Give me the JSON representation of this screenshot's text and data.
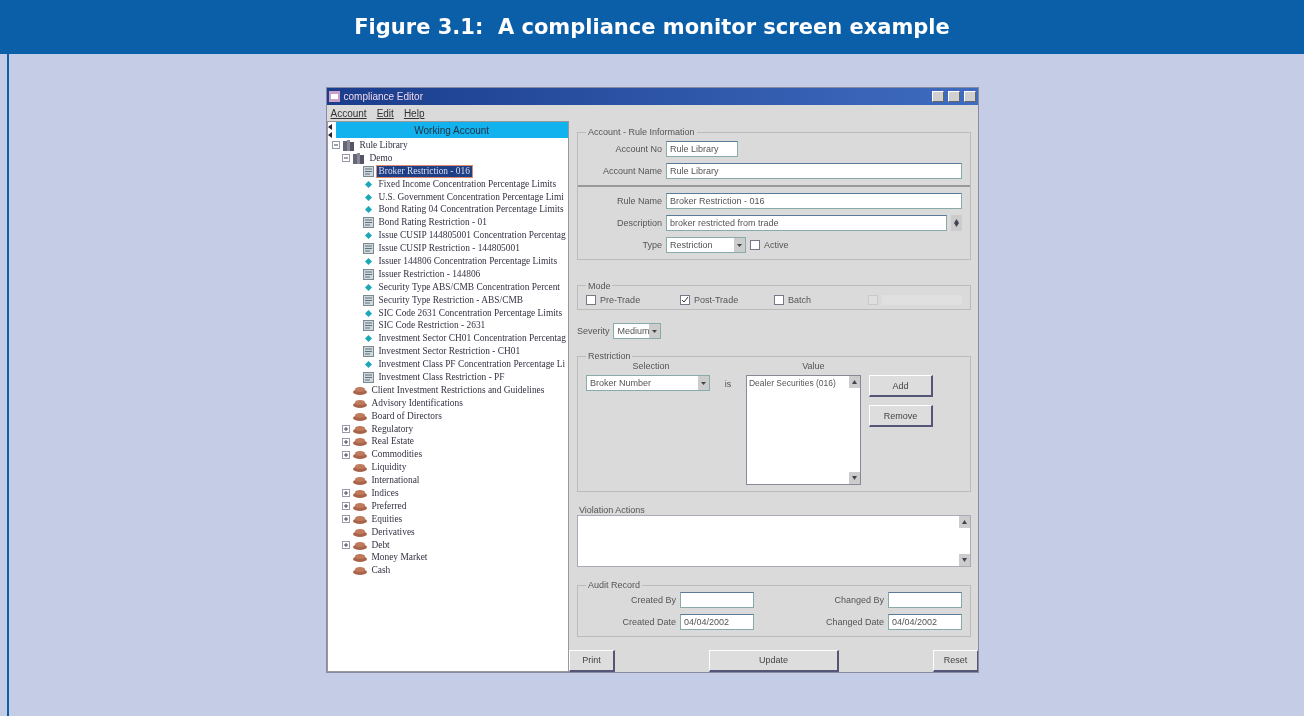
{
  "figure": {
    "caption": "Figure 3.1:  A compliance monitor screen example"
  },
  "window": {
    "title": "compliance Editor"
  },
  "menu": [
    {
      "label": "Account"
    },
    {
      "label": "Edit"
    },
    {
      "label": "Help"
    }
  ],
  "tree": {
    "header": "Working Account",
    "items": [
      {
        "label": "Rule Library",
        "kind": "library",
        "expanded": true,
        "selected": false,
        "children": [
          {
            "label": "Demo",
            "kind": "library",
            "expanded": true,
            "selected": false,
            "children": [
              {
                "label": "Broker Restriction - 016",
                "kind": "restriction",
                "selected": true
              },
              {
                "label": "Fixed Income Concentration Percentage Limits",
                "kind": "concentration",
                "selected": false
              },
              {
                "label": "U.S. Government Concentration Percentage Limi",
                "kind": "concentration",
                "selected": false
              },
              {
                "label": "Bond Rating 04 Concentration Percentage Limits",
                "kind": "concentration",
                "selected": false
              },
              {
                "label": "Bond Rating Restriction - 01",
                "kind": "restriction",
                "selected": false
              },
              {
                "label": "Issue CUSIP 144805001 Concentration Percentag",
                "kind": "concentration",
                "selected": false
              },
              {
                "label": "Issue CUSIP Restriction - 144805001",
                "kind": "restriction",
                "selected": false
              },
              {
                "label": "Issuer 144806 Concentration Percentage Limits",
                "kind": "concentration",
                "selected": false
              },
              {
                "label": "Issuer Restriction - 144806",
                "kind": "restriction",
                "selected": false
              },
              {
                "label": "Security Type ABS/CMB Concentration Percent",
                "kind": "concentration",
                "selected": false
              },
              {
                "label": "Security Type Restriction - ABS/CMB",
                "kind": "restriction",
                "selected": false
              },
              {
                "label": "SIC Code 2631 Concentration Percentage Limits",
                "kind": "concentration",
                "selected": false
              },
              {
                "label": "SIC Code Restriction - 2631",
                "kind": "restriction",
                "selected": false
              },
              {
                "label": "Investment Sector CH01 Concentration Percentag",
                "kind": "concentration",
                "selected": false
              },
              {
                "label": "Investment Sector Restriction - CH01",
                "kind": "restriction",
                "selected": false
              },
              {
                "label": "Investment Class PF Concentration Percentage Li",
                "kind": "concentration",
                "selected": false
              },
              {
                "label": "Investment Class Restriction - PF",
                "kind": "restriction",
                "selected": false
              }
            ]
          },
          {
            "label": "Client Investment Restrictions and Guidelines",
            "kind": "group",
            "selected": false
          },
          {
            "label": "Advisory Identifications",
            "kind": "group",
            "selected": false
          },
          {
            "label": "Board of Directors",
            "kind": "group",
            "selected": false
          },
          {
            "label": "Regulatory",
            "kind": "group",
            "expanded": false,
            "selected": false
          },
          {
            "label": "Real Estate",
            "kind": "group",
            "expanded": false,
            "selected": false
          },
          {
            "label": "Commodities",
            "kind": "group",
            "expanded": false,
            "selected": false
          },
          {
            "label": "Liquidity",
            "kind": "group",
            "selected": false
          },
          {
            "label": "International",
            "kind": "group",
            "selected": false
          },
          {
            "label": "Indices",
            "kind": "group",
            "expanded": false,
            "selected": false
          },
          {
            "label": "Preferred",
            "kind": "group",
            "expanded": false,
            "selected": false
          },
          {
            "label": "Equities",
            "kind": "group",
            "expanded": false,
            "selected": false
          },
          {
            "label": "Derivatives",
            "kind": "group",
            "selected": false
          },
          {
            "label": "Debt",
            "kind": "group",
            "expanded": false,
            "selected": false
          },
          {
            "label": "Money Market",
            "kind": "group",
            "selected": false
          },
          {
            "label": "Cash",
            "kind": "group",
            "selected": false
          }
        ]
      }
    ]
  },
  "account_group": {
    "title": "Account - Rule Information",
    "account_no": {
      "label": "Account No",
      "value": "Rule Library"
    },
    "account_name": {
      "label": "Account Name",
      "value": "Rule Library"
    }
  },
  "rule": {
    "rule_name": {
      "label": "Rule Name",
      "value": "Broker Restriction - 016"
    },
    "description": {
      "label": "Description",
      "value": "broker restricted from trade"
    },
    "type": {
      "label": "Type",
      "value": "Restriction"
    },
    "active": {
      "label": "Active",
      "checked": false
    }
  },
  "mode": {
    "title": "Mode",
    "options": [
      {
        "label": "Pre-Trade",
        "checked": false,
        "disabled": false
      },
      {
        "label": "Post-Trade",
        "checked": true,
        "disabled": false
      },
      {
        "label": "Batch",
        "checked": false,
        "disabled": false
      },
      {
        "checked": false,
        "disabled": true
      }
    ]
  },
  "severity": {
    "label": "Severity",
    "value": "Medium"
  },
  "restriction": {
    "title": "Restriction",
    "selection_header": "Selection",
    "value_header": "Value",
    "selection": "Broker Number",
    "operator": "is",
    "values": [
      "Dealer Securities (016)"
    ],
    "buttons": [
      {
        "label": "Add"
      },
      {
        "label": "Remove"
      }
    ]
  },
  "violation_actions": {
    "title": "Violation Actions"
  },
  "audit": {
    "title": "Audit Record",
    "created_by": {
      "label": "Created By"
    },
    "changed_by": {
      "label": "Changed By"
    },
    "created_date": {
      "label": "Created Date",
      "value": "04/04/2002"
    },
    "changed_date": {
      "label": "Changed Date",
      "value": "04/04/2002"
    }
  },
  "buttons": [
    {
      "label": "Print"
    },
    {
      "label": "Update"
    },
    {
      "label": "Reset"
    }
  ]
}
